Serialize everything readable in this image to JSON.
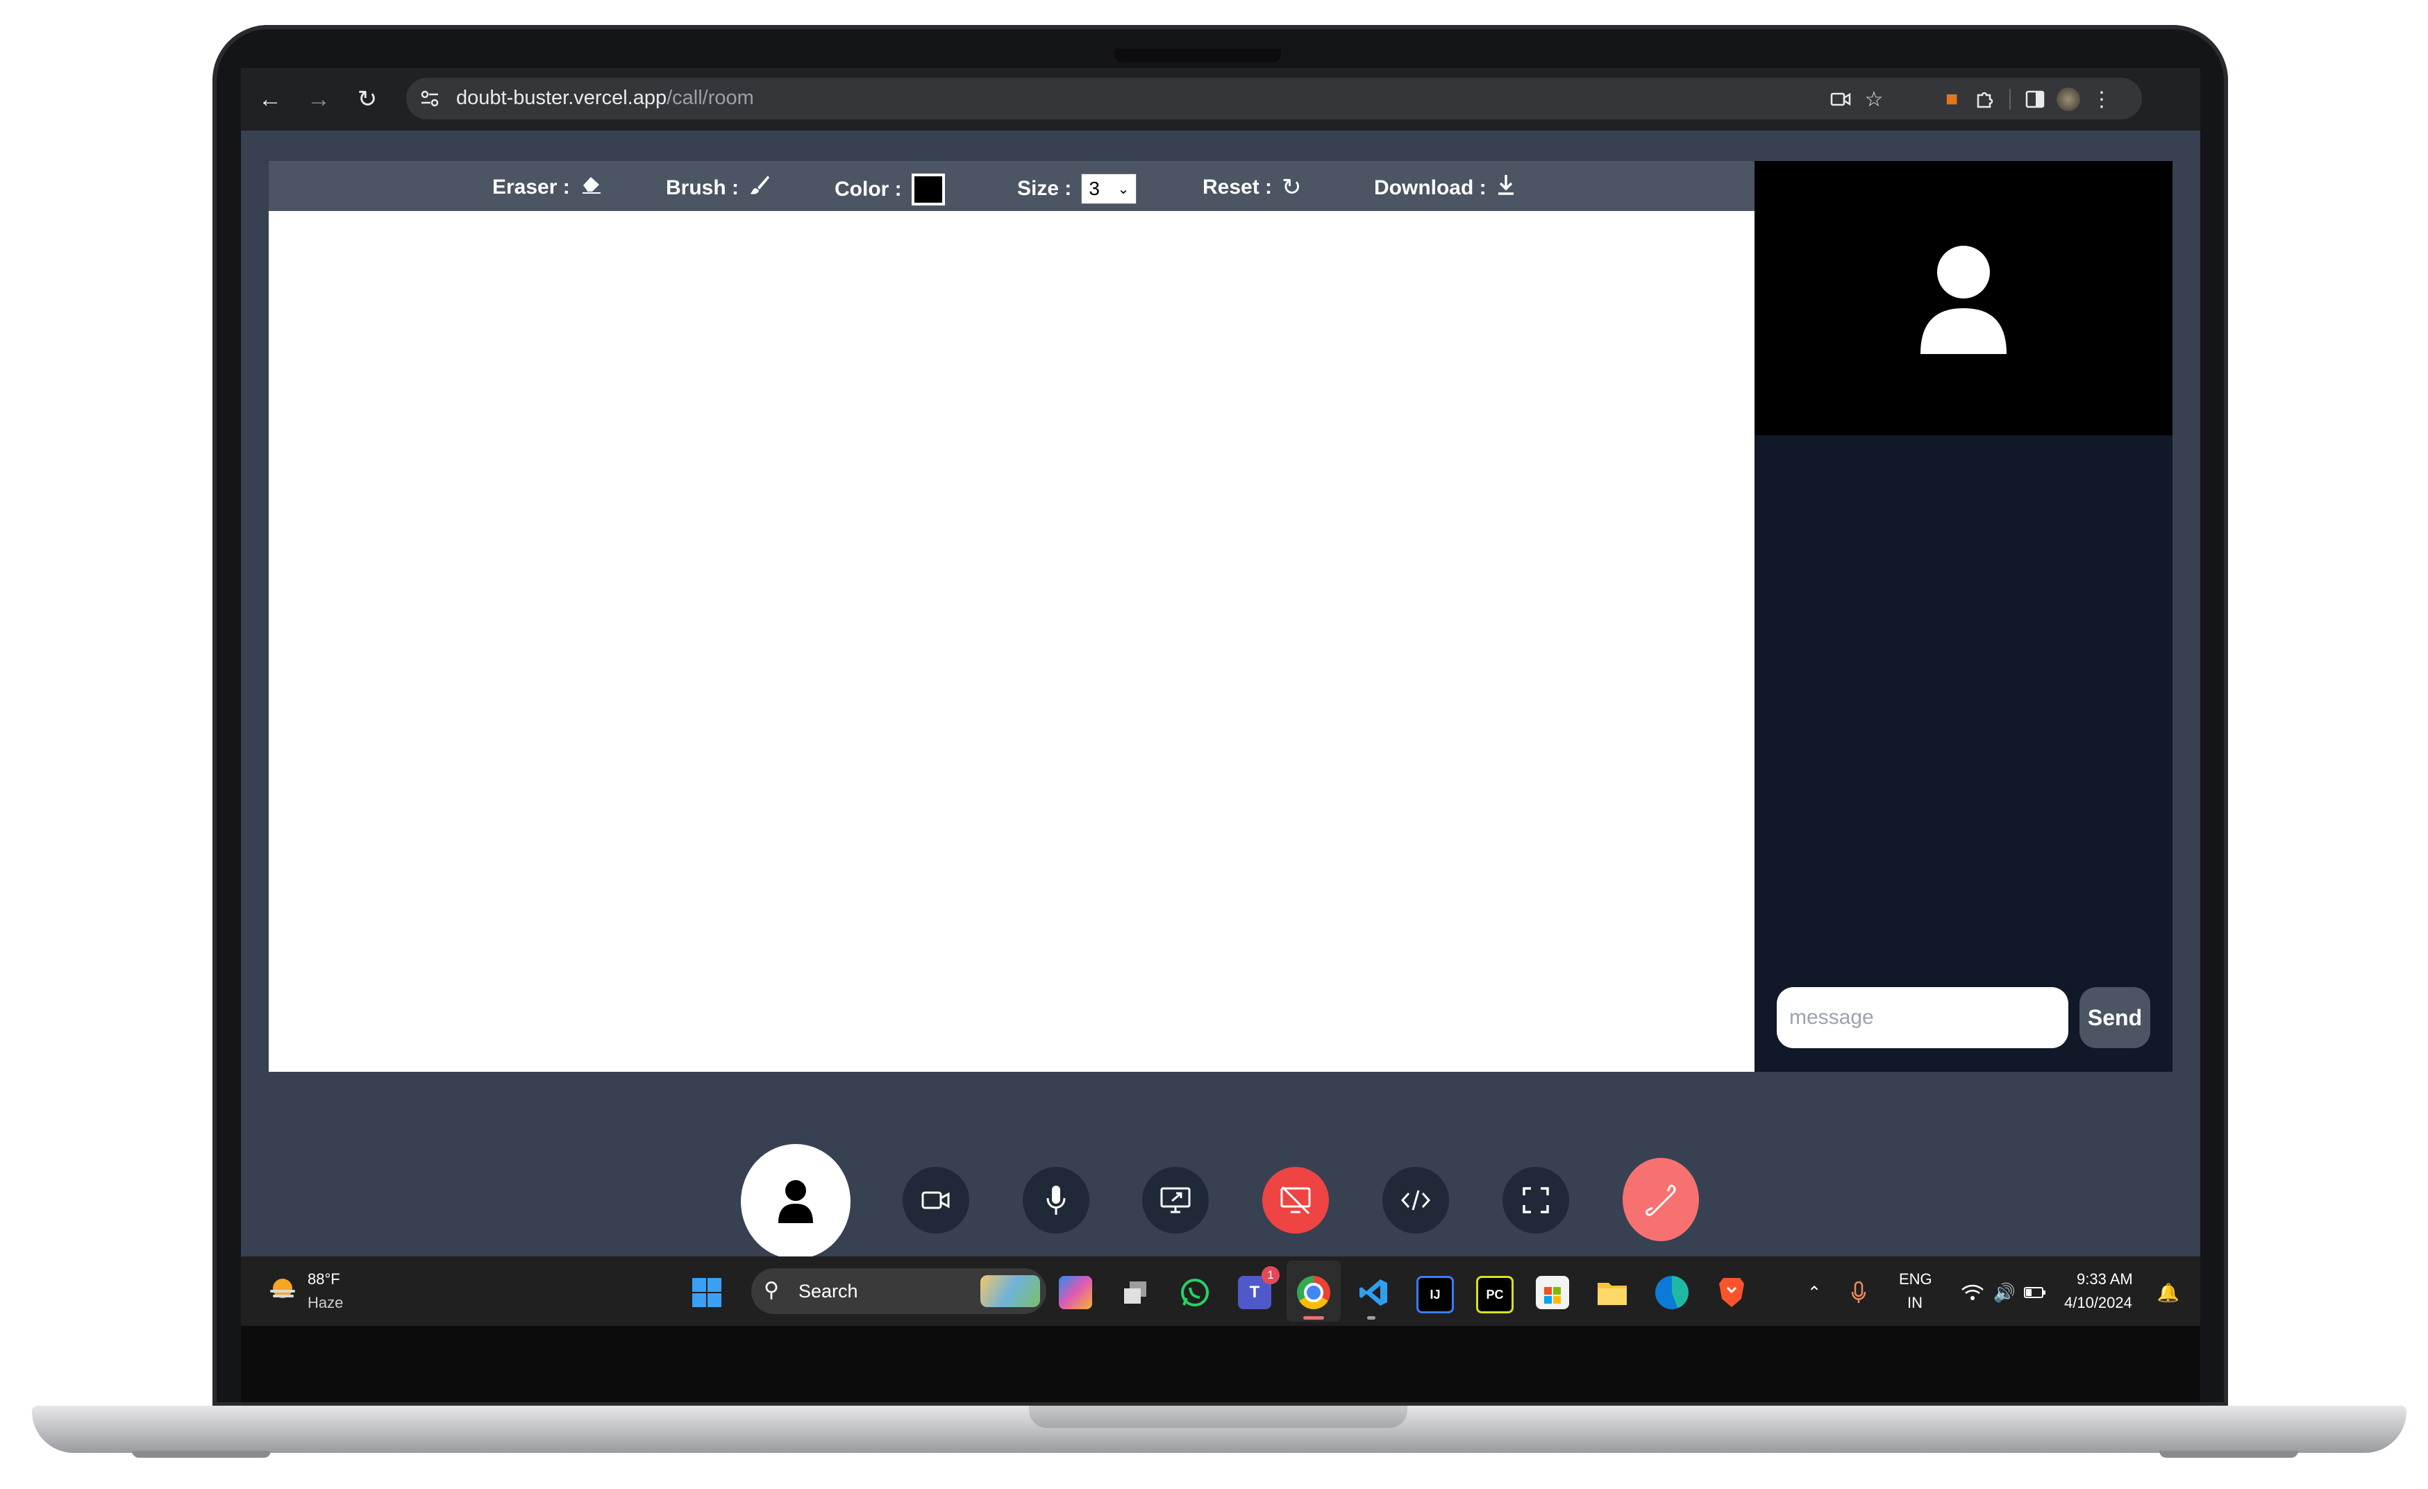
{
  "browser": {
    "url_host": "doubt-buster.vercel.app",
    "url_path": "/call/room"
  },
  "toolbar": {
    "eraser_label": "Eraser :",
    "brush_label": "Brush :",
    "color_label": "Color :",
    "color_value": "#000000",
    "size_label": "Size :",
    "size_value": "3",
    "reset_label": "Reset :",
    "download_label": "Download :"
  },
  "chat": {
    "placeholder": "message",
    "send_label": "Send"
  },
  "controls": [
    {
      "name": "participants-button",
      "icon": "user-icon"
    },
    {
      "name": "camera-button",
      "icon": "video-camera-icon"
    },
    {
      "name": "microphone-button",
      "icon": "microphone-icon"
    },
    {
      "name": "screen-share-button",
      "icon": "screen-share-icon"
    },
    {
      "name": "stop-screen-share-button",
      "icon": "screen-share-off-icon"
    },
    {
      "name": "code-editor-button",
      "icon": "code-icon"
    },
    {
      "name": "fullscreen-button",
      "icon": "fullscreen-icon"
    },
    {
      "name": "end-call-button",
      "icon": "phone-hangup-icon"
    }
  ],
  "taskbar": {
    "weather_temp": "88°F",
    "weather_desc": "Haze",
    "search_label": "Search",
    "teams_badge": "1",
    "lang_line1": "ENG",
    "lang_line2": "IN",
    "time": "9:33 AM",
    "date": "4/10/2024"
  },
  "colors": {
    "app_bg": "#374151",
    "toolbar_bg": "#4b5563",
    "side_bg": "#111827",
    "control_bg": "#1f2937",
    "danger": "#ef4444",
    "end_call": "#f87171"
  }
}
